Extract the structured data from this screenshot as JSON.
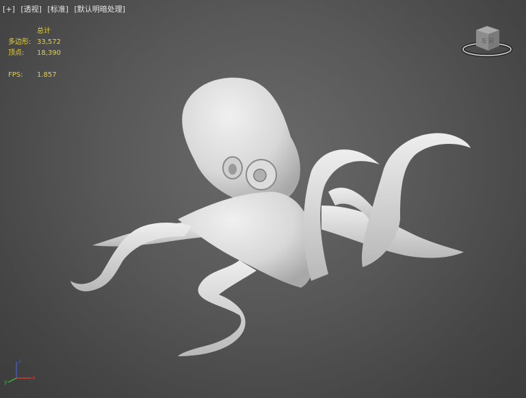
{
  "viewport": {
    "labels": [
      "[+]",
      "[透视]",
      "[标准]",
      "[默认明暗处理]"
    ]
  },
  "stats": {
    "header": "总计",
    "polygons_label": "多边形:",
    "polygons_value": "33,572",
    "vertices_label": "顶点:",
    "vertices_value": "18,390",
    "fps_label": "FPS:",
    "fps_value": "1.857"
  },
  "viewcube": {
    "face_label": "左 前"
  },
  "axis_tripod": {
    "x": "x",
    "y": "y",
    "z": "z"
  },
  "colors": {
    "stats_text": "#e8d13a",
    "model": "#e4e4e4",
    "axis_x": "#d23a2a",
    "axis_y": "#3ab23a",
    "axis_z": "#3a5ad2"
  }
}
